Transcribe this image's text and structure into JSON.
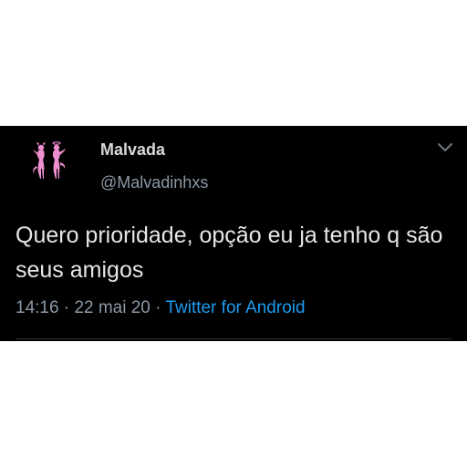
{
  "tweet": {
    "display_name": "Malvada",
    "handle": "@Malvadinhxs",
    "text": "Quero prioridade, opção eu ja tenho q são seus amigos",
    "time": "14:16",
    "separator_1": " · ",
    "date": "22 mai 20",
    "separator_2": " · ",
    "source": "Twitter for Android"
  },
  "icons": {
    "avatar": "devil-angel-silhouettes-icon",
    "menu": "chevron-down-icon"
  },
  "colors": {
    "background": "#000000",
    "text": "#e6e6e6",
    "muted": "#8b98a5",
    "link": "#1d9bf0",
    "avatar_pink": "#f08fd0"
  }
}
